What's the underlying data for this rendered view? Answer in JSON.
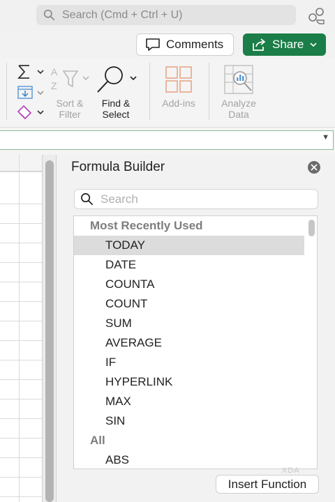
{
  "search": {
    "placeholder": "Search (Cmd + Ctrl + U)"
  },
  "toolbar": {
    "comments_label": "Comments",
    "share_label": "Share"
  },
  "ribbon": {
    "sort_filter_label_1": "Sort &",
    "sort_filter_label_2": "Filter",
    "find_select_label_1": "Find &",
    "find_select_label_2": "Select",
    "addins_label": "Add-ins",
    "analyze_label_1": "Analyze",
    "analyze_label_2": "Data"
  },
  "colors": {
    "share_green": "#1b7d47",
    "eraser_purple": "#b23fb8",
    "autosum_blue": "#3b82c4",
    "addins_orange": "#e8a788"
  },
  "formula_builder": {
    "title": "Formula Builder",
    "search_placeholder": "Search",
    "sections": [
      {
        "header": "Most Recently Used",
        "items": [
          "TODAY",
          "DATE",
          "COUNTA",
          "COUNT",
          "SUM",
          "AVERAGE",
          "IF",
          "HYPERLINK",
          "MAX",
          "SIN"
        ]
      },
      {
        "header": "All",
        "items": [
          "ABS"
        ]
      }
    ],
    "selected_item": "TODAY",
    "insert_label": "Insert Function"
  },
  "watermark": "XDA"
}
